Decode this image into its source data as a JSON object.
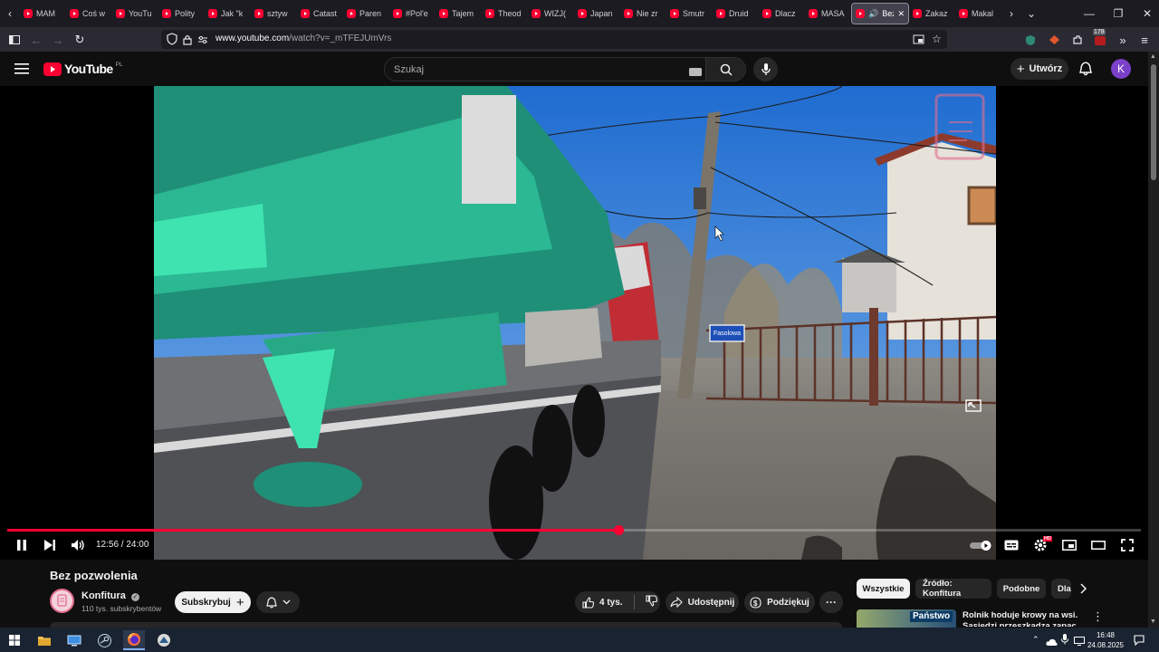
{
  "browser": {
    "tabs": [
      {
        "label": "MAM"
      },
      {
        "label": "Coś w"
      },
      {
        "label": "YouTu"
      },
      {
        "label": "Polity"
      },
      {
        "label": "Jak \"k"
      },
      {
        "label": "sztyw"
      },
      {
        "label": "Catast"
      },
      {
        "label": "Paren"
      },
      {
        "label": "#Pol'e"
      },
      {
        "label": "Tajem"
      },
      {
        "label": "Theod"
      },
      {
        "label": "WIZJ("
      },
      {
        "label": "Japan"
      },
      {
        "label": "Nie zr"
      },
      {
        "label": "Smutr"
      },
      {
        "label": "Druid"
      },
      {
        "label": "Dlacz"
      },
      {
        "label": "MASA"
      },
      {
        "label": "Bez",
        "active": true
      },
      {
        "label": "Zakaz"
      },
      {
        "label": "Makal"
      }
    ],
    "url": {
      "domain": "www.youtube.com",
      "path": "/watch?v=_mTFEJUmVrs"
    },
    "extension_badge": "178"
  },
  "youtube": {
    "logo_text": "YouTube",
    "region": "PL",
    "search_placeholder": "Szukaj",
    "create_label": "Utwórz",
    "avatar_letter": "K",
    "accent": "#ff0033"
  },
  "player": {
    "current_time": "12:56",
    "duration": "24:00",
    "progress": 0.539,
    "street_sign": "Fasolowa",
    "hd_badge": "HD"
  },
  "video": {
    "title": "Bez pozwolenia",
    "channel": "Konfitura",
    "subscribers": "110 tys. subskrybentów",
    "subscribe_label": "Subskrybuj",
    "likes": "4 tys.",
    "share_label": "Udostępnij",
    "thanks_label": "Podziękuj"
  },
  "recommendations": {
    "chips": [
      {
        "label": "Wszystkie",
        "selected": true
      },
      {
        "label": "Źródło: Konfitura"
      },
      {
        "label": "Podobne"
      },
      {
        "label": "Dla"
      }
    ],
    "first_title": "Rolnik hoduje krowy na wsi. Sąsiedzi przeszkadza zapac...",
    "first_thumb_text": "Państwo"
  },
  "taskbar": {
    "time": "16:48",
    "date": "24.08.2025"
  }
}
